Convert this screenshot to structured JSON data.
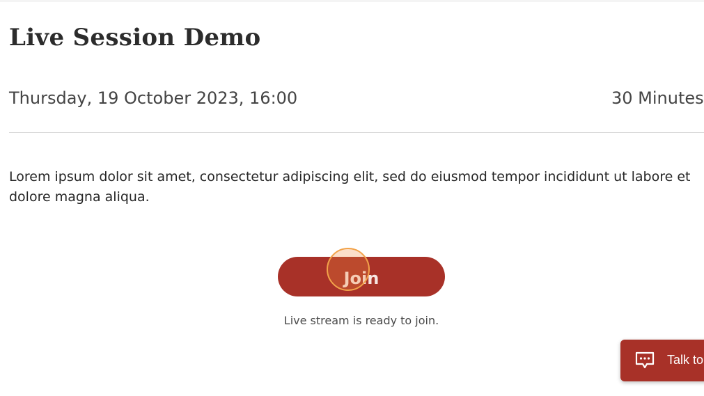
{
  "session": {
    "title": "Live Session Demo",
    "datetime": "Thursday, 19 October 2023, 16:00",
    "duration": "30 Minutes",
    "description": "Lorem ipsum dolor sit amet, consectetur adipiscing elit, sed do eiusmod tempor incididunt ut labore et dolore magna aliqua."
  },
  "join": {
    "button_label": "Join",
    "status_text": "Live stream is ready to join."
  },
  "support": {
    "button_label": "Talk to us",
    "icon": "chat-bubble-icon"
  },
  "colors": {
    "accent": "#a83128",
    "background": "#ffffff",
    "text": "#2b2b2b"
  }
}
